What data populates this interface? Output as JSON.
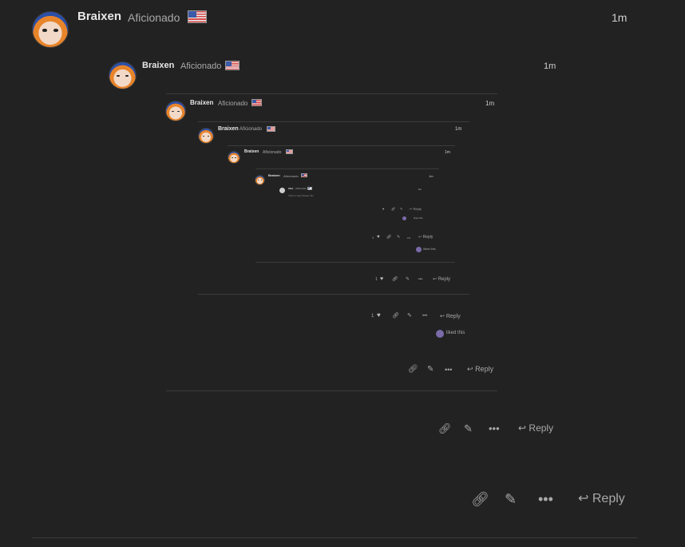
{
  "posts": {
    "l0": {
      "username": "Braixen",
      "user_title": "Aficionado",
      "date": "1m",
      "reply": "Reply",
      "avatar": "user-avatar",
      "flag": "us-flag-icon"
    },
    "l1": {
      "username": "Braixen",
      "user_title": "Aficionado",
      "date": "1m",
      "reply": "Reply"
    },
    "l2": {
      "username": "Braixen",
      "user_title": "Aficionado",
      "date": "1m",
      "reply": "Reply",
      "like_count": "1",
      "liked_text": "liked this"
    },
    "l3": {
      "username": "Braixen",
      "user_title": "Aficionado",
      "date": "1m",
      "reply": "Reply",
      "like_count": "1"
    },
    "l4": {
      "username": "Braixen",
      "user_title": "Aficionado",
      "date": "1m",
      "reply": "Reply",
      "like_count": "1",
      "liked_text": "liked this"
    },
    "l5": {
      "username": "Braixen",
      "user_title": "Aficionado",
      "date": "1m",
      "reply": "Reply",
      "liked_text": "liked this"
    },
    "l6": {
      "username": "Alex",
      "user_title": "Aficionado",
      "date": "1m",
      "text": "Click to Like Please this"
    }
  },
  "icons": {
    "link": "link-icon",
    "edit": "pencil-icon",
    "more": "ellipsis-icon",
    "reply": "reply-arrow-icon",
    "like": "heart-icon"
  },
  "colors": {
    "background": "#222222",
    "text": "#dddddd",
    "muted": "#a8a8a8",
    "divider": "#3b3b3b"
  }
}
